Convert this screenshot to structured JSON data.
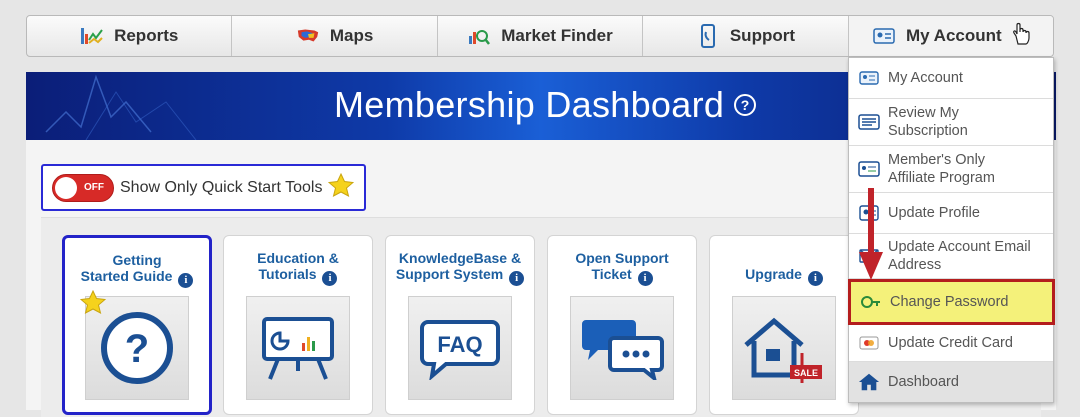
{
  "nav": {
    "items": [
      {
        "label": "Reports",
        "icon": "reports-chart-icon"
      },
      {
        "label": "Maps",
        "icon": "us-map-icon"
      },
      {
        "label": "Market Finder",
        "icon": "market-finder-icon"
      },
      {
        "label": "Support",
        "icon": "phone-icon"
      },
      {
        "label": "My Account",
        "icon": "account-card-icon"
      }
    ]
  },
  "banner": {
    "title": "Membership Dashboard",
    "help": "?"
  },
  "toggle": {
    "state": "OFF",
    "label": "Show Only Quick Start Tools"
  },
  "tools": [
    {
      "line1": "Getting",
      "line2": "Started Guide",
      "info": "i",
      "selected": true
    },
    {
      "line1": "Education &",
      "line2": "Tutorials",
      "info": "i"
    },
    {
      "line1": "KnowledgeBase &",
      "line2": "Support System",
      "info": "i"
    },
    {
      "line1": "Open Support",
      "line2": "Ticket",
      "info": "i"
    },
    {
      "line1": "",
      "line2": "Upgrade",
      "info": "i"
    }
  ],
  "faq_text": "FAQ",
  "sale_text": "SALE",
  "dropdown": {
    "items": [
      {
        "line1": "My Account",
        "line2": "",
        "icon": "account-card-icon"
      },
      {
        "line1": "Review My",
        "line2": "Subscription",
        "icon": "subscription-list-icon"
      },
      {
        "line1": "Member's Only",
        "line2": "Affiliate Program",
        "icon": "affiliate-card-icon"
      },
      {
        "line1": "Update Profile",
        "line2": "",
        "icon": "profile-id-icon"
      },
      {
        "line1": "Update Account Email",
        "line2": "Address",
        "icon": "email-icon"
      },
      {
        "line1": "Change Password",
        "line2": "",
        "icon": "password-key-icon"
      },
      {
        "line1": "Update Credit Card",
        "line2": "",
        "icon": "credit-card-icon"
      },
      {
        "line1": "Dashboard",
        "line2": "",
        "icon": "home-icon"
      }
    ]
  },
  "colors": {
    "accent_blue": "#1d5fa0",
    "highlight": "#f4f17a",
    "highlight_border": "#b41d1d",
    "toggle_red": "#d72a27"
  }
}
